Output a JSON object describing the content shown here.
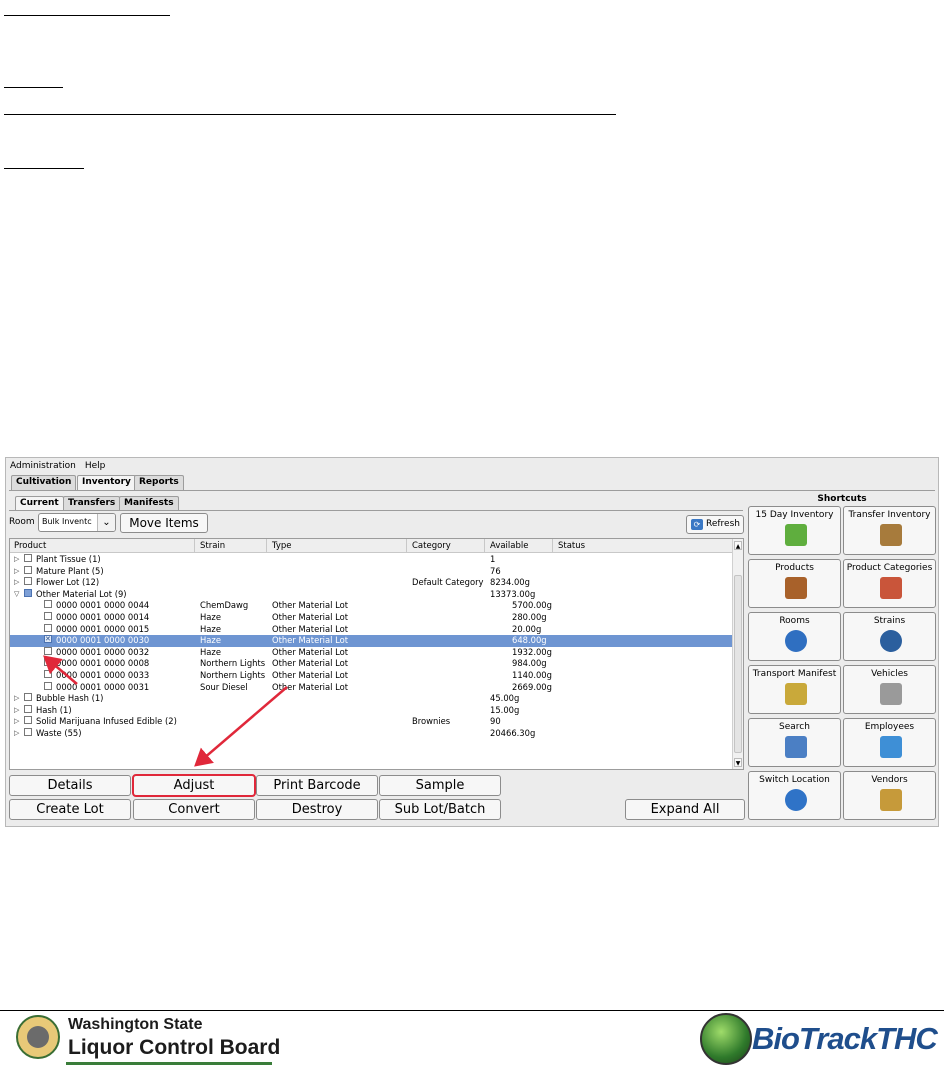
{
  "menu": [
    "Administration",
    "Help"
  ],
  "main_tabs": [
    "Cultivation",
    "Inventory",
    "Reports"
  ],
  "sub_tabs": [
    "Current",
    "Transfers",
    "Manifests"
  ],
  "toolbar": {
    "room_label": "Room",
    "room_value": "Bulk Inventc",
    "move_items": "Move Items",
    "refresh": "Refresh"
  },
  "columns": [
    "Product",
    "Strain",
    "Type",
    "Category",
    "Available",
    "Status"
  ],
  "rows": [
    {
      "level": 0,
      "expander": "▷",
      "product": "Plant Tissue (1)",
      "strain": "",
      "type": "",
      "category": "",
      "available": "1",
      "checked": false
    },
    {
      "level": 0,
      "expander": "▷",
      "product": "Mature Plant (5)",
      "strain": "",
      "type": "",
      "category": "",
      "available": "76",
      "checked": false
    },
    {
      "level": 0,
      "expander": "▷",
      "product": "Flower Lot (12)",
      "strain": "",
      "type": "",
      "category": "Default Category",
      "available": "8234.00g",
      "checked": false
    },
    {
      "level": 0,
      "expander": "▽",
      "product": "Other Material Lot (9)",
      "strain": "",
      "type": "",
      "category": "",
      "available": "13373.00g",
      "checked": "partial"
    },
    {
      "level": 1,
      "expander": "",
      "product": "0000 0001 0000 0044",
      "strain": "ChemDawg",
      "type": "Other Material Lot",
      "category": "",
      "available": "5700.00g",
      "checked": false
    },
    {
      "level": 1,
      "expander": "",
      "product": "0000 0001 0000 0014",
      "strain": "Haze",
      "type": "Other Material Lot",
      "category": "",
      "available": "280.00g",
      "checked": false
    },
    {
      "level": 1,
      "expander": "",
      "product": "0000 0001 0000 0015",
      "strain": "Haze",
      "type": "Other Material Lot",
      "category": "",
      "available": "20.00g",
      "checked": false
    },
    {
      "level": 1,
      "expander": "",
      "product": "0000 0001 0000 0030",
      "strain": "Haze",
      "type": "Other Material Lot",
      "category": "",
      "available": "648.00g",
      "checked": true,
      "selected": true
    },
    {
      "level": 1,
      "expander": "",
      "product": "0000 0001 0000 0032",
      "strain": "Haze",
      "type": "Other Material Lot",
      "category": "",
      "available": "1932.00g",
      "checked": false
    },
    {
      "level": 1,
      "expander": "",
      "product": "0000 0001 0000 0008",
      "strain": "Northern Lights",
      "type": "Other Material Lot",
      "category": "",
      "available": "984.00g",
      "checked": false
    },
    {
      "level": 1,
      "expander": "",
      "product": "0000 0001 0000 0033",
      "strain": "Northern Lights",
      "type": "Other Material Lot",
      "category": "",
      "available": "1140.00g",
      "checked": false
    },
    {
      "level": 1,
      "expander": "",
      "product": "0000 0001 0000 0031",
      "strain": "Sour Diesel",
      "type": "Other Material Lot",
      "category": "",
      "available": "2669.00g",
      "checked": false
    },
    {
      "level": 0,
      "expander": "▷",
      "product": "Bubble Hash (1)",
      "strain": "",
      "type": "",
      "category": "",
      "available": "45.00g",
      "checked": false
    },
    {
      "level": 0,
      "expander": "▷",
      "product": "Hash (1)",
      "strain": "",
      "type": "",
      "category": "",
      "available": "15.00g",
      "checked": false
    },
    {
      "level": 0,
      "expander": "▷",
      "product": "Solid Marijuana Infused Edible (2)",
      "strain": "",
      "type": "",
      "category": "Brownies",
      "available": "90",
      "checked": false
    },
    {
      "level": 0,
      "expander": "▷",
      "product": "Waste (55)",
      "strain": "",
      "type": "",
      "category": "",
      "available": "20466.30g",
      "checked": false
    }
  ],
  "actions": {
    "details": "Details",
    "adjust": "Adjust",
    "print_barcode": "Print Barcode",
    "sample": "Sample",
    "create_lot": "Create Lot",
    "convert": "Convert",
    "destroy": "Destroy",
    "sub_lot_batch": "Sub Lot/Batch",
    "expand_all": "Expand All"
  },
  "shortcuts": {
    "title": "Shortcuts",
    "items": [
      {
        "label": "15 Day Inventory",
        "icon": "inventory-box-icon"
      },
      {
        "label": "Transfer Inventory",
        "icon": "transfer-box-icon"
      },
      {
        "label": "Products",
        "icon": "products-box-icon"
      },
      {
        "label": "Product Categories",
        "icon": "categories-box-icon"
      },
      {
        "label": "Rooms",
        "icon": "rooms-house-icon"
      },
      {
        "label": "Strains",
        "icon": "strains-globe-icon"
      },
      {
        "label": "Transport Manifest",
        "icon": "manifest-checklist-icon"
      },
      {
        "label": "Vehicles",
        "icon": "vehicle-car-icon"
      },
      {
        "label": "Search",
        "icon": "magnifier-icon"
      },
      {
        "label": "Employees",
        "icon": "employees-people-icon"
      },
      {
        "label": "Switch Location",
        "icon": "switch-location-icon"
      },
      {
        "label": "Vendors",
        "icon": "vendors-icon"
      }
    ]
  },
  "footer": {
    "wslcb_line1": "Washington State",
    "wslcb_line2": "Liquor Control Board",
    "biotrack": "BioTrackTHC"
  },
  "colors": {
    "selection": "#6e95d2",
    "annotation": "#e0283a",
    "brand_blue": "#1f4e8c"
  }
}
